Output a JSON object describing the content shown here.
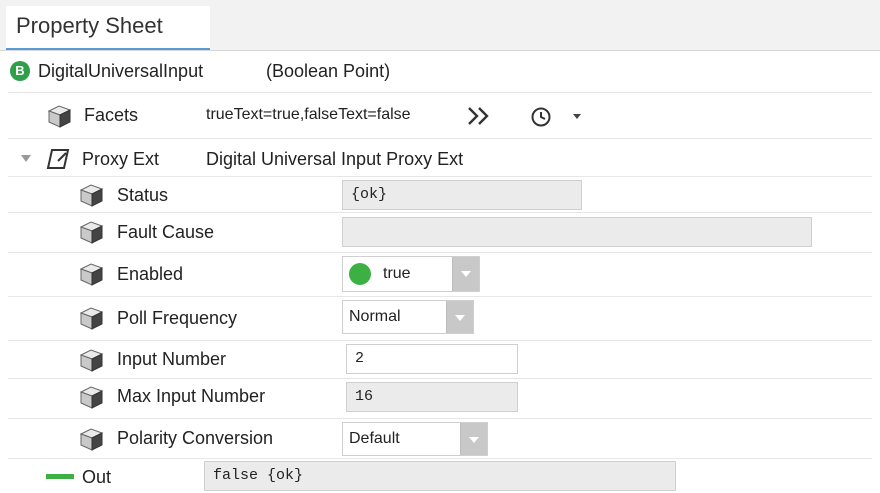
{
  "tab": {
    "label": "Property Sheet"
  },
  "root": {
    "badge": "B",
    "name": "DigitalUniversalInput",
    "type": "(Boolean Point)"
  },
  "facets": {
    "label": "Facets",
    "value": "trueText=true,falseText=false"
  },
  "proxy": {
    "label": "Proxy Ext",
    "value": "Digital Universal Input Proxy Ext"
  },
  "properties": {
    "status": {
      "label": "Status",
      "value": "{ok}"
    },
    "fault_cause": {
      "label": "Fault Cause",
      "value": ""
    },
    "enabled": {
      "label": "Enabled",
      "value": "true",
      "dot_color": "#3cb043"
    },
    "poll_frequency": {
      "label": "Poll Frequency",
      "value": "Normal"
    },
    "input_number": {
      "label": "Input Number",
      "value": "2"
    },
    "max_input_number": {
      "label": "Max Input Number",
      "value": "16"
    },
    "polarity_conversion": {
      "label": "Polarity Conversion",
      "value": "Default"
    }
  },
  "out": {
    "label": "Out",
    "value": "false {ok}"
  },
  "icons": {
    "property": "cube-icon",
    "more": "double-chevron-right-icon",
    "history": "clock-icon",
    "expand": "triangle-down-icon",
    "proxy": "proxy-ext-icon",
    "out": "green-bar-icon"
  },
  "colors": {
    "accent": "#5b9bd5",
    "boolean_green": "#2ea04a",
    "out_bar": "#3cb043"
  }
}
